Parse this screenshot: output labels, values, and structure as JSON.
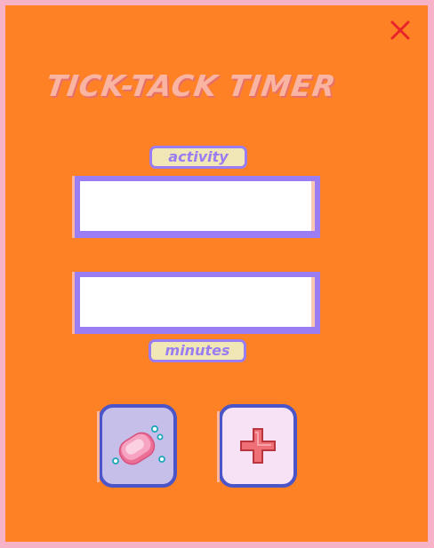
{
  "app": {
    "title": "TICK-TACK TIMER"
  },
  "window": {
    "close_icon": "close-icon"
  },
  "form": {
    "activity_label": "activity",
    "activity_value": "",
    "minutes_label": "minutes",
    "minutes_value": ""
  },
  "buttons": {
    "clear_icon": "soap-icon",
    "add_icon": "plus-icon"
  },
  "colors": {
    "background": "#ff8125",
    "border": "#f7b2c8",
    "title": "#f9b4a2",
    "accent": "#9a7df2",
    "label_fill": "#f1e6b6",
    "close": "#e8232a",
    "button_border": "#4b55c8"
  }
}
